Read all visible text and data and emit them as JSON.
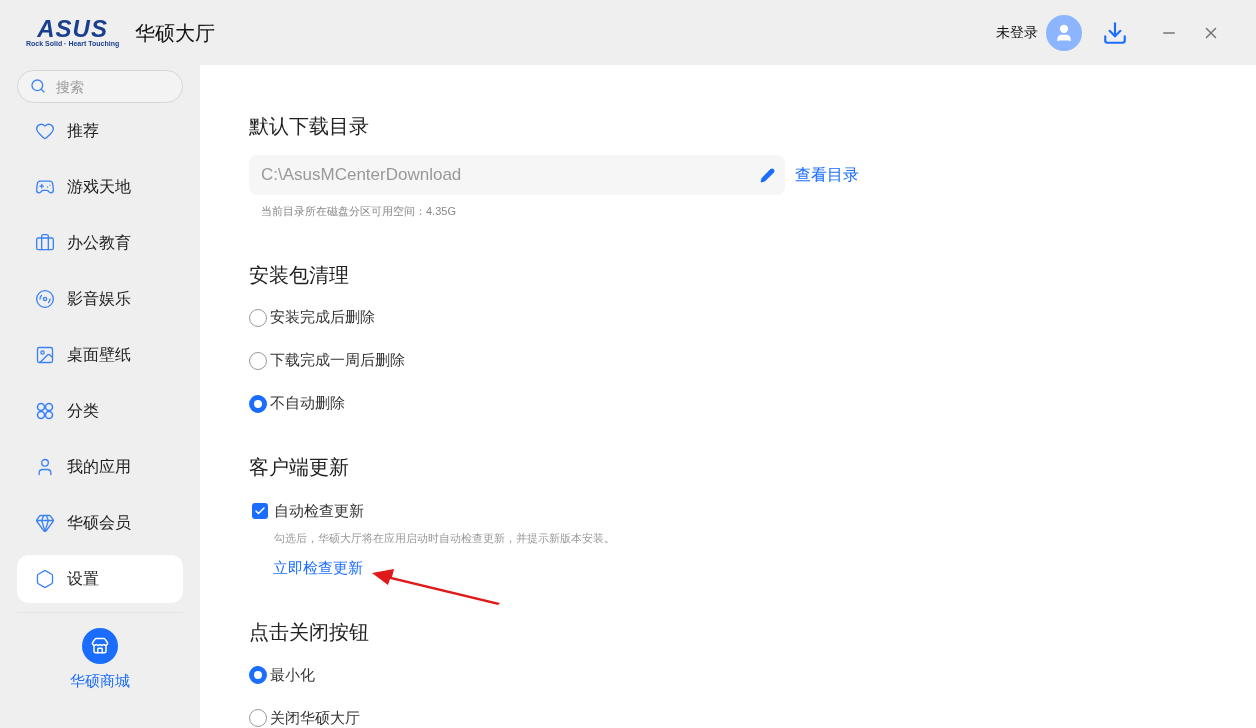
{
  "header": {
    "logo": {
      "wordmark": "ASUS",
      "tagline": "Rock Solid · Heart Touching"
    },
    "title": "华硕大厅",
    "login": "未登录"
  },
  "sidebar": {
    "search": {
      "placeholder": "搜索"
    },
    "items": [
      {
        "kind": "heart",
        "label": "推荐",
        "selected": false
      },
      {
        "kind": "gamepad",
        "label": "游戏天地",
        "selected": false
      },
      {
        "kind": "briefcase",
        "label": "办公教育",
        "selected": false
      },
      {
        "kind": "reel",
        "label": "影音娱乐",
        "selected": false
      },
      {
        "kind": "image",
        "label": "桌面壁纸",
        "selected": false
      },
      {
        "kind": "grid",
        "label": "分类",
        "selected": false
      },
      {
        "kind": "user",
        "label": "我的应用",
        "selected": false
      },
      {
        "kind": "gem",
        "label": "华硕会员",
        "selected": false
      },
      {
        "kind": "settings",
        "label": "设置",
        "selected": true
      }
    ],
    "store": "华硕商城"
  },
  "settings": {
    "download_dir": {
      "title": "默认下载目录",
      "value": "C:\\AsusMCenterDownload",
      "link": "查看目录",
      "note": "当前目录所在磁盘分区可用空间：4.35G"
    },
    "cleanup": {
      "title": "安装包清理",
      "options": [
        {
          "label": "安装完成后删除",
          "selected": false
        },
        {
          "label": "下载完成一周后删除",
          "selected": false
        },
        {
          "label": "不自动删除",
          "selected": true
        }
      ]
    },
    "update": {
      "title": "客户端更新",
      "checkbox": {
        "label": "自动检查更新",
        "checked": true
      },
      "note": "勾选后，华硕大厅将在应用启动时自动检查更新，并提示新版本安装。",
      "link": "立即检查更新"
    },
    "close_button": {
      "title": "点击关闭按钮",
      "options": [
        {
          "label": "最小化",
          "selected": true
        },
        {
          "label": "关闭华硕大厅",
          "selected": false
        }
      ]
    }
  }
}
